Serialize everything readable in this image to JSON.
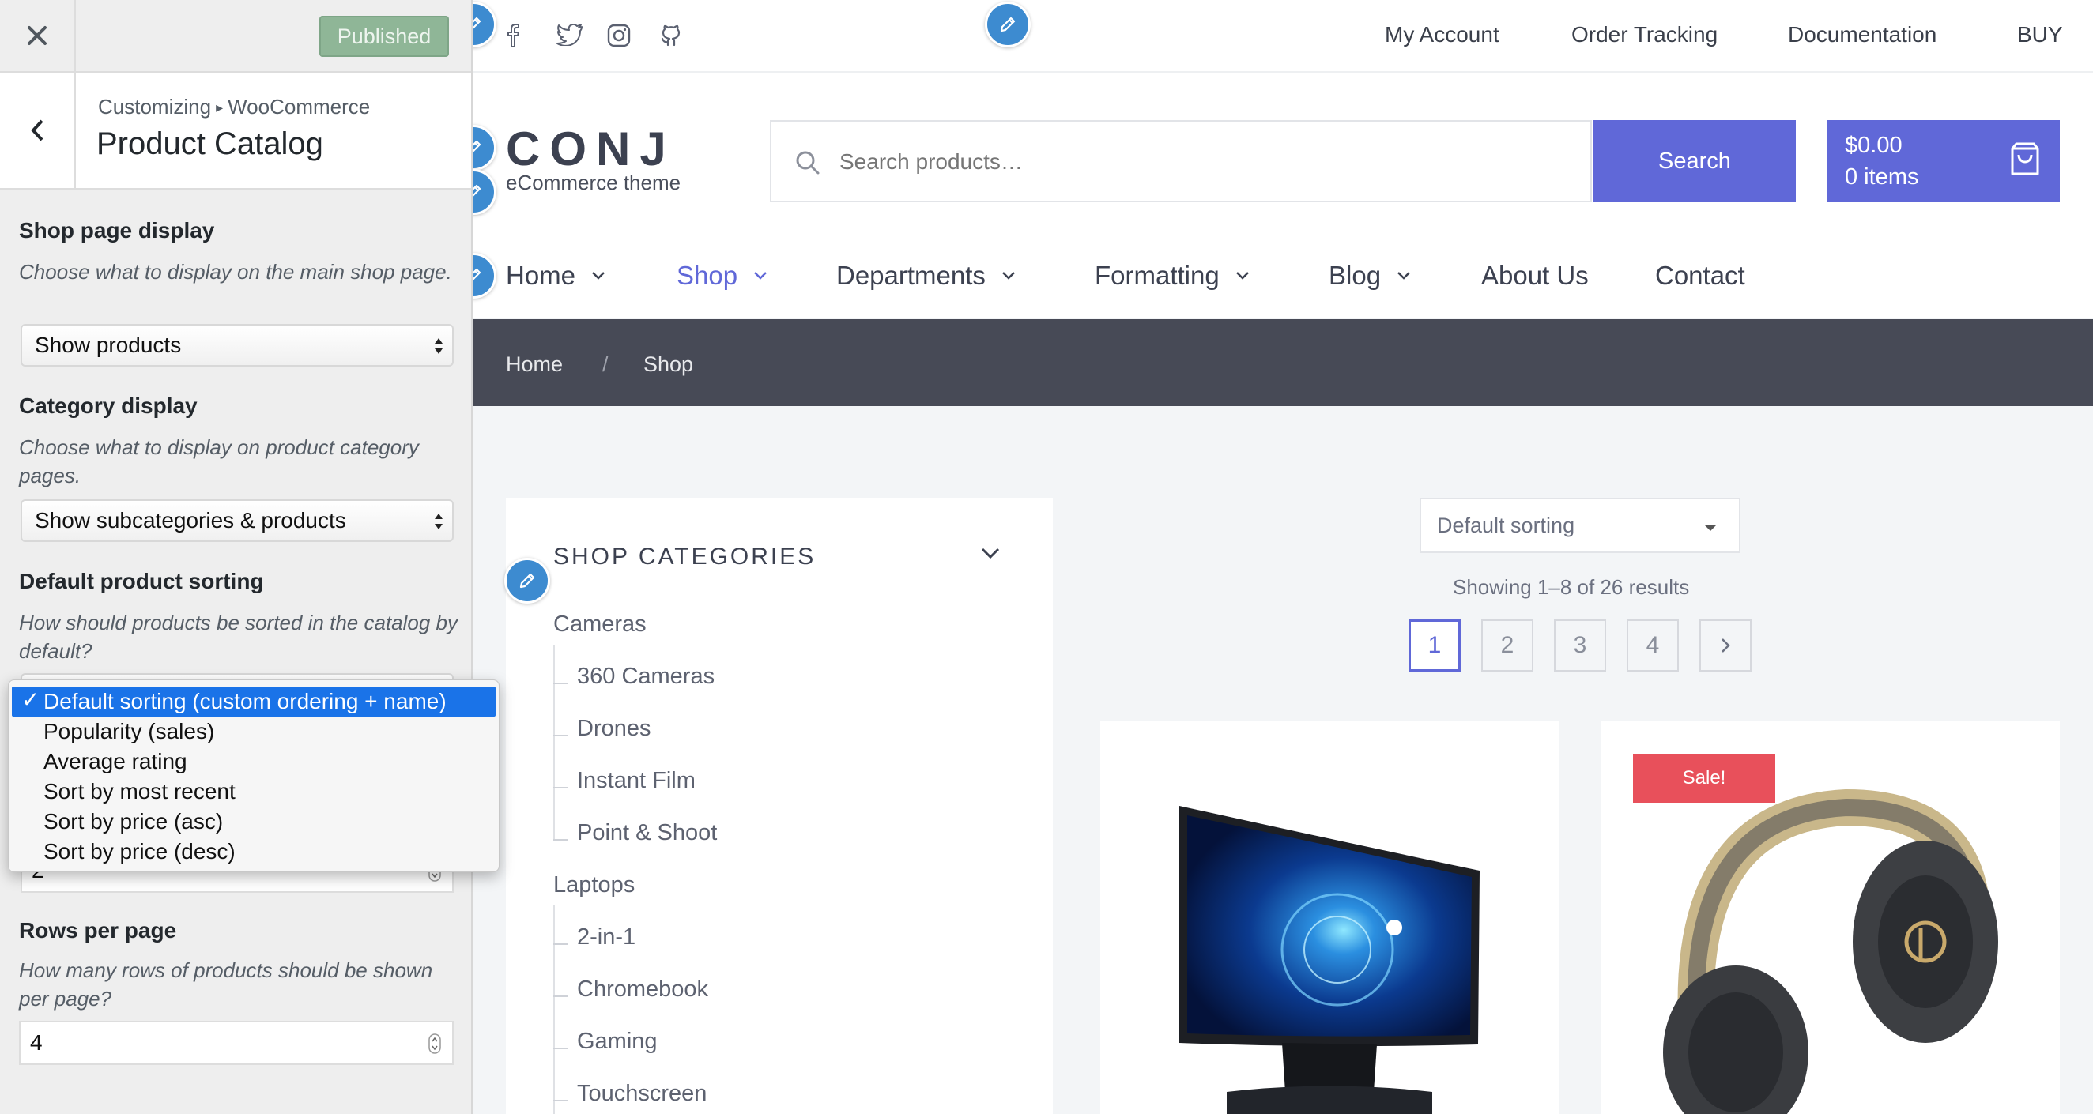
{
  "customizer": {
    "publish_label": "Published",
    "breadcrumb": {
      "root": "Customizing",
      "separator": "▸",
      "section": "WooCommerce"
    },
    "title": "Product Catalog",
    "shop_display": {
      "label": "Shop page display",
      "description": "Choose what to display on the main shop page.",
      "value": "Show products"
    },
    "category_display": {
      "label": "Category display",
      "description": "Choose what to display on product category pages.",
      "value": "Show subcategories & products"
    },
    "default_sorting": {
      "label": "Default product sorting",
      "description": "How should products be sorted in the catalog by default?",
      "options": [
        "Default sorting (custom ordering + name)",
        "Popularity (sales)",
        "Average rating",
        "Sort by most recent",
        "Sort by price (asc)",
        "Sort by price (desc)"
      ],
      "selected_index": 0,
      "check_mark": "✓"
    },
    "products_per_row_value": "2",
    "rows_per_page": {
      "label": "Rows per page",
      "description": "How many rows of products should be shown per page?",
      "value": "4"
    }
  },
  "site": {
    "social_icons": [
      "facebook-icon",
      "twitter-icon",
      "instagram-icon",
      "github-icon"
    ],
    "top_links": [
      "My Account",
      "Order Tracking",
      "Documentation",
      "BUY"
    ],
    "logo_title": "CONJ",
    "logo_tagline": "eCommerce theme",
    "search": {
      "placeholder": "Search products…",
      "button": "Search"
    },
    "cart": {
      "total": "$0.00",
      "count": "0 items"
    },
    "nav": [
      {
        "label": "Home",
        "dropdown": true,
        "active": false
      },
      {
        "label": "Shop",
        "dropdown": true,
        "active": true
      },
      {
        "label": "Departments",
        "dropdown": true,
        "active": false
      },
      {
        "label": "Formatting",
        "dropdown": true,
        "active": false
      },
      {
        "label": "Blog",
        "dropdown": true,
        "active": false
      },
      {
        "label": "About Us",
        "dropdown": false,
        "active": false
      },
      {
        "label": "Contact",
        "dropdown": false,
        "active": false
      }
    ],
    "breadcrumb": {
      "home": "Home",
      "separator": "/",
      "current": "Shop"
    },
    "categories_widget": {
      "title": "SHOP CATEGORIES",
      "groups": [
        {
          "name": "Cameras",
          "children": [
            "360 Cameras",
            "Drones",
            "Instant Film",
            "Point & Shoot"
          ]
        },
        {
          "name": "Laptops",
          "children": [
            "2-in-1",
            "Chromebook",
            "Gaming",
            "Touchscreen"
          ]
        }
      ]
    },
    "sorting_value": "Default sorting",
    "result_count": "Showing 1–8 of 26 results",
    "pagination": {
      "pages": [
        "1",
        "2",
        "3",
        "4"
      ],
      "current": "1",
      "next": "›"
    },
    "products": [
      {
        "image": "curved-monitor-image",
        "sale": false
      },
      {
        "image": "headphones-image",
        "sale": true,
        "badge": "Sale!"
      }
    ],
    "colors": {
      "accent": "#6068d8",
      "sale": "#e8505b",
      "breadcrumb_bg": "#474a56",
      "edit_pin": "#3d8bd0"
    }
  }
}
